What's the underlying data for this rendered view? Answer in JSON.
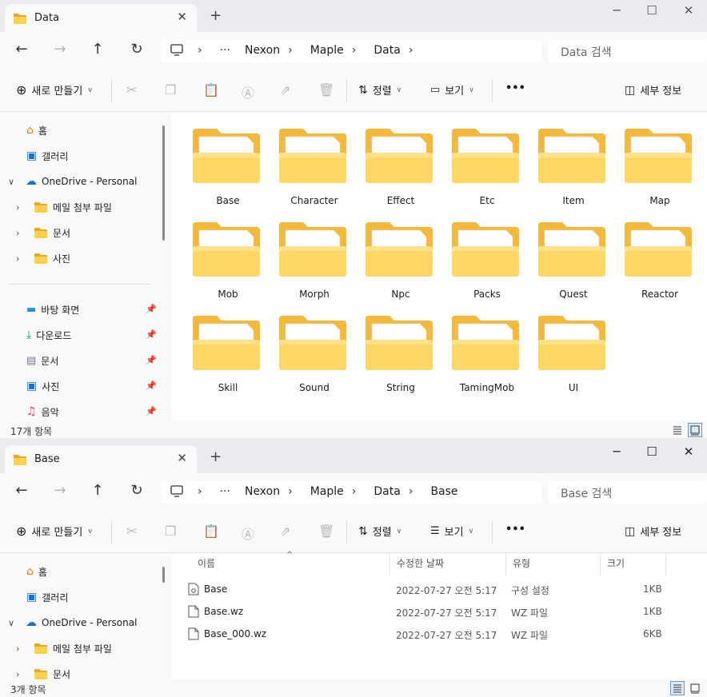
{
  "window1": {
    "tab_title": "Data",
    "address": [
      "Nexon",
      "Maple",
      "Data"
    ],
    "search_placeholder": "Data 검색",
    "toolbar": {
      "new": "새로 만들기",
      "sort": "정렬",
      "view": "보기",
      "more": "•••",
      "details": "세부 정보"
    },
    "nav": {
      "home": "홈",
      "gallery": "갤러리",
      "onedrive": "OneDrive - Personal",
      "mail": "메일 첨부 파일",
      "docs": "문서",
      "photos": "사진",
      "desktop": "바탕 화면",
      "downloads": "다운로드",
      "documents": "문서",
      "pictures": "사진",
      "music": "음악"
    },
    "folders": [
      "Base",
      "Character",
      "Effect",
      "Etc",
      "Item",
      "Map",
      "Mob",
      "Morph",
      "Npc",
      "Packs",
      "Quest",
      "Reactor",
      "Skill",
      "Sound",
      "String",
      "TamingMob",
      "UI"
    ],
    "status": "17개 항목"
  },
  "window2": {
    "tab_title": "Base",
    "address": [
      "Nexon",
      "Maple",
      "Data",
      "Base"
    ],
    "search_placeholder": "Base 검색",
    "toolbar": {
      "new": "새로 만들기",
      "sort": "정렬",
      "view": "보기",
      "more": "•••",
      "details": "세부 정보"
    },
    "nav": {
      "home": "홈",
      "gallery": "갤러리",
      "onedrive": "OneDrive - Personal",
      "mail": "메일 첨부 파일",
      "docs": "문서"
    },
    "columns": {
      "name": "이름",
      "modified": "수정한 날짜",
      "type": "유형",
      "size": "크기"
    },
    "files": [
      {
        "name": "Base",
        "modified": "2022-07-27 오전 5:17",
        "type": "구성 설정",
        "size": "1KB"
      },
      {
        "name": "Base.wz",
        "modified": "2022-07-27 오전 5:17",
        "type": "WZ 파일",
        "size": "1KB"
      },
      {
        "name": "Base_000.wz",
        "modified": "2022-07-27 오전 5:17",
        "type": "WZ 파일",
        "size": "6KB"
      }
    ],
    "status": "3개 항목"
  },
  "colors": {
    "folder_back": "#f4c04a",
    "folder_front": "#ffd767",
    "accent": "#0a64c8"
  }
}
